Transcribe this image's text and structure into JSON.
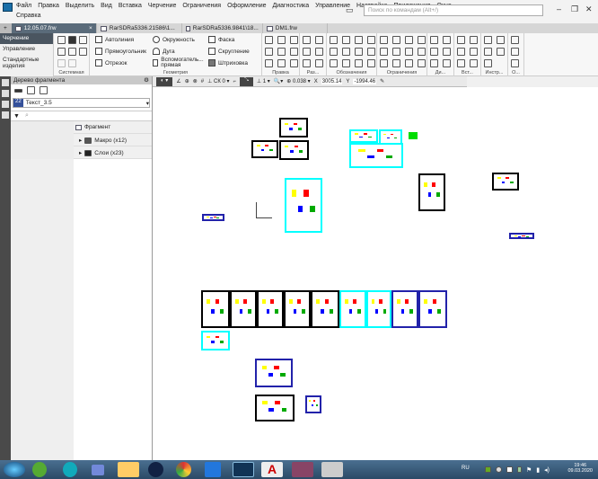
{
  "menu": {
    "row1": [
      "Файл",
      "Правка",
      "Выделить",
      "Вид",
      "Вставка",
      "Черчение",
      "Ограничения",
      "Оформление",
      "Диагностика",
      "Управление",
      "Настройка",
      "Приложения",
      "Окно"
    ],
    "row2": [
      "Справка"
    ],
    "search_placeholder": "Поиск по командам (Alt+/)"
  },
  "tabs": [
    {
      "label": "12.05.07.frw",
      "active": true,
      "close": "×"
    },
    {
      "label": "RarSDRa5336.21586\\1..."
    },
    {
      "label": "RarSDRa5336.9841\\18..."
    },
    {
      "label": "DM1.frw"
    }
  ],
  "modes": [
    "Черчение",
    "Управление",
    "Стандартные изделия"
  ],
  "ribbon": {
    "groups": [
      "Системная",
      "Геометрия",
      "Правка",
      "Раз...",
      "Обозначения",
      "Ограничения",
      "Ди...",
      "Вст...",
      "Инстр...",
      "О..."
    ],
    "geometry_tools": [
      "Автолиния",
      "Окружность",
      "Фаска",
      "Прямоугольник",
      "Дуга",
      "Скругление",
      "Отрезок",
      "Вспомогатель... прямая",
      "Штриховка"
    ]
  },
  "tree": {
    "title": "Дерево фрагмента",
    "style_num": "22",
    "style": "Текст_3.5",
    "root": "Фрагмент",
    "items": [
      "Макро (x12)",
      "Слои (x23)"
    ]
  },
  "viewbar": {
    "cs": "СК 0",
    "layer": "1",
    "zoom": "0.038",
    "x_label": "X",
    "x": "3005.14",
    "y_label": "Y",
    "y": "-1994.46"
  },
  "tray": {
    "lang": "RU",
    "time": "19:46",
    "date": "09.03.2020"
  }
}
